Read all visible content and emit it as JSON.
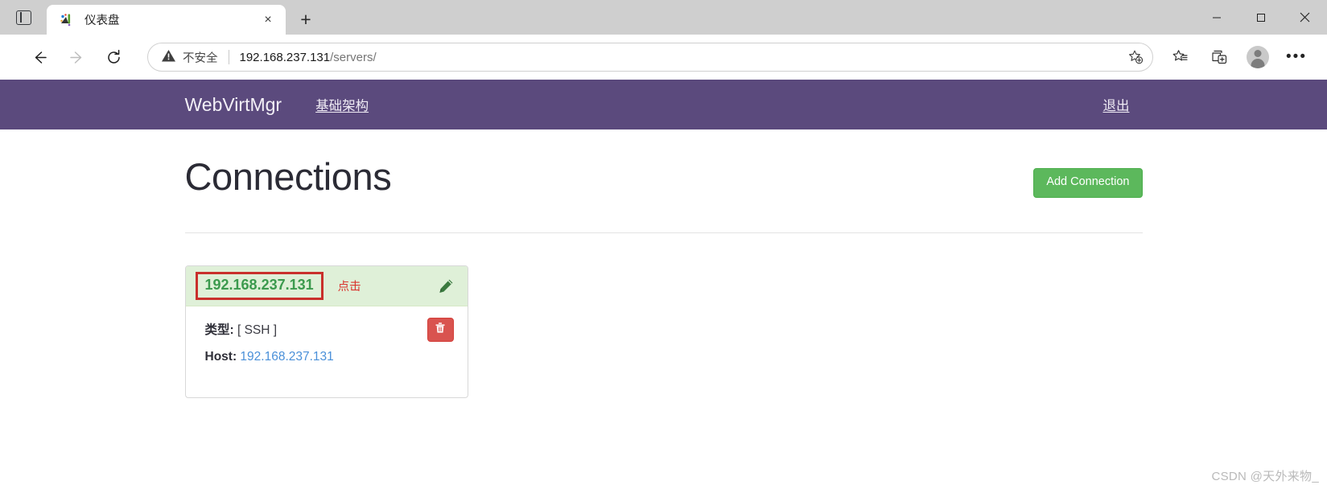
{
  "browser": {
    "tab": {
      "title": "仪表盘",
      "favicon": "webvirtmgr-favicon",
      "close_label": "×"
    },
    "new_tab_label": "+",
    "window_controls": {
      "minimize": "minimize-icon",
      "maximize": "maximize-icon",
      "close": "close-icon"
    },
    "nav": {
      "back": "back-arrow-icon",
      "forward": "forward-arrow-icon",
      "reload": "reload-icon"
    },
    "omnibox": {
      "security_label": "不安全",
      "security_icon": "warning-triangle-icon",
      "separator": "|",
      "url_host": "192.168.237.131",
      "url_path": "/servers/",
      "favorite_icon": "add-favorite-star-icon"
    },
    "toolbar_icons": {
      "favorites": "favorites-star-list-icon",
      "collections": "collections-icon",
      "profile": "profile-avatar-icon",
      "settings": "more-options-ellipsis"
    }
  },
  "navbar": {
    "brand": "WebVirtMgr",
    "link_infrastructure": "基础架构",
    "link_logout": "退出",
    "background_color": "#5b4a7d"
  },
  "page": {
    "title": "Connections",
    "add_button": "Add Connection",
    "add_button_color": "#5cb85c"
  },
  "connections": [
    {
      "name": "192.168.237.131",
      "name_color": "#3c9a4e",
      "highlight_border_color": "#c9302c",
      "annotation": "点击",
      "annotation_color": "#d9352f",
      "edit_icon": "pencil-icon",
      "delete_icon": "trash-icon",
      "delete_button_color": "#d9534f",
      "fields": [
        {
          "label": "类型:",
          "value": "[ SSH ]",
          "is_link": false
        },
        {
          "label": "Host:",
          "value": "192.168.237.131",
          "is_link": true
        }
      ]
    }
  ],
  "watermark": "CSDN @天外来物_"
}
